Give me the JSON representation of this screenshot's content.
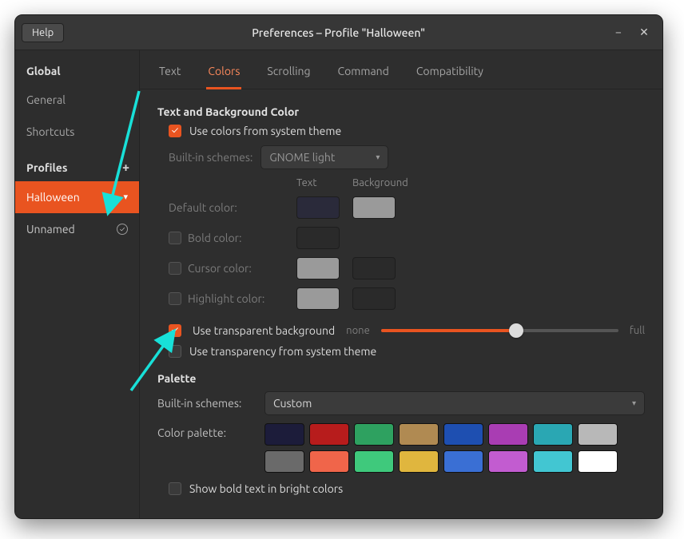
{
  "titlebar": {
    "help": "Help",
    "title": "Preferences – Profile \"Halloween\""
  },
  "sidebar": {
    "global": "Global",
    "items": [
      "General",
      "Shortcuts"
    ],
    "profiles_label": "Profiles",
    "profiles": [
      {
        "name": "Halloween",
        "active": true
      },
      {
        "name": "Unnamed",
        "active": false
      }
    ]
  },
  "tabs": [
    "Text",
    "Colors",
    "Scrolling",
    "Command",
    "Compatibility"
  ],
  "active_tab": "Colors",
  "colors": {
    "section1": "Text and Background Color",
    "use_system": "Use colors from system theme",
    "builtin_label": "Built-in schemes:",
    "builtin_value": "GNOME light",
    "th_text": "Text",
    "th_bg": "Background",
    "default_color": "Default color:",
    "bold_color": "Bold color:",
    "cursor_color": "Cursor color:",
    "highlight_color": "Highlight color:",
    "swatches": {
      "default_text": "#2a2a3a",
      "default_bg": "#9a9a9a",
      "bold_text": "#2a2a2a",
      "cursor_text": "#9a9a9a",
      "cursor_bg": "#2a2a2a",
      "highlight_text": "#9a9a9a",
      "highlight_bg": "#2a2a2a"
    },
    "use_transparent": "Use transparent background",
    "none": "none",
    "full": "full",
    "slider_pct": 57,
    "use_trans_system": "Use transparency from system theme",
    "section2": "Palette",
    "palette_builtin_label": "Built-in schemes:",
    "palette_builtin_value": "Custom",
    "palette_label": "Color palette:",
    "palette": [
      "#1c1c3a",
      "#b71c1c",
      "#2ea160",
      "#b08a52",
      "#1e4fb1",
      "#a93db3",
      "#2aa7b3",
      "#b8b8b8",
      "#6a6a6a",
      "#f0654a",
      "#3fc97c",
      "#e0b63e",
      "#3a6fd4",
      "#c25cd0",
      "#42c6d2",
      "#ffffff"
    ],
    "show_bold": "Show bold text in bright colors"
  }
}
